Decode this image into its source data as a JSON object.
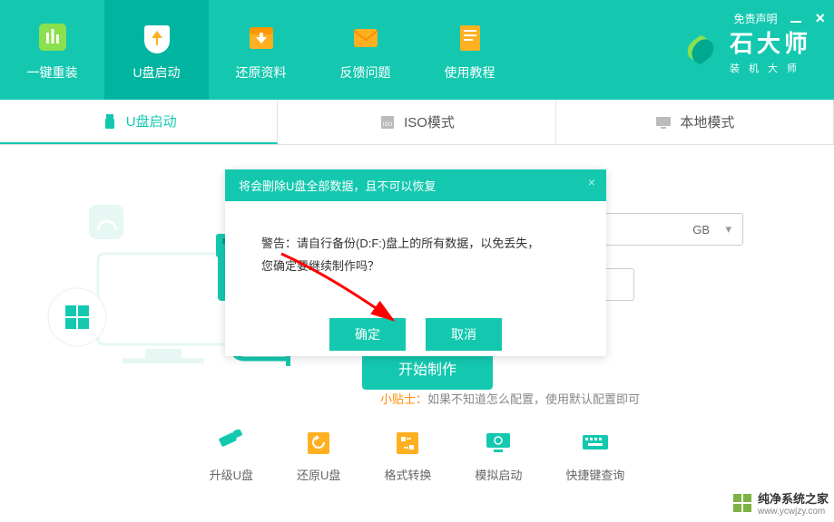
{
  "window": {
    "disclaimer": "免责声明"
  },
  "brand": {
    "title": "石大师",
    "sub": "装机大师"
  },
  "nav": [
    {
      "label": "一键重装"
    },
    {
      "label": "U盘启动"
    },
    {
      "label": "还原资料"
    },
    {
      "label": "反馈问题"
    },
    {
      "label": "使用教程"
    }
  ],
  "tabs": [
    {
      "label": "U盘启动"
    },
    {
      "label": "ISO模式"
    },
    {
      "label": "本地模式"
    }
  ],
  "select": {
    "visible_suffix": "GB"
  },
  "start_btn": "开始制作",
  "tip": {
    "label": "小贴士：",
    "text": "如果不知道怎么配置，使用默认配置即可"
  },
  "bottom": [
    {
      "label": "升级U盘"
    },
    {
      "label": "还原U盘"
    },
    {
      "label": "格式转换"
    },
    {
      "label": "模拟启动"
    },
    {
      "label": "快捷键查询"
    }
  ],
  "modal": {
    "title": "将会删除U盘全部数据，且不可以恢复",
    "line1": "警告：请自行备份(D:F:)盘上的所有数据，以免丢失，",
    "line2": "您确定要继续制作吗？",
    "ok": "确定",
    "cancel": "取消"
  },
  "watermark": {
    "title": "纯净系统之家",
    "url": "www.ycwjzy.com"
  }
}
